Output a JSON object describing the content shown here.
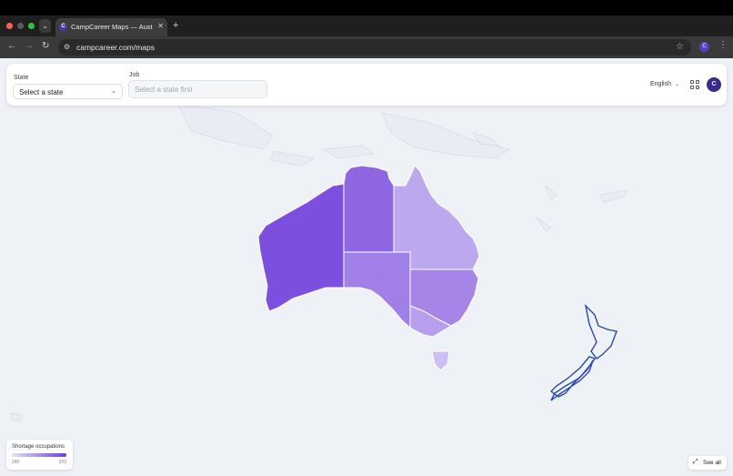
{
  "browser": {
    "tab_title": "CampCareer Maps — Australi",
    "tab_favicon_letter": "C",
    "url": "campcareer.com/maps",
    "profile_initial": "C",
    "icons": [
      "back-icon",
      "forward-icon",
      "reload-icon",
      "site-settings-icon",
      "star-icon",
      "kebab-menu-icon"
    ]
  },
  "filters": {
    "state_label": "State",
    "state_value": "Select a state",
    "job_label": "Job",
    "job_placeholder": "Select a state first"
  },
  "header": {
    "language": "English",
    "avatar_initial": "C"
  },
  "legend": {
    "title": "Shortage occupations",
    "min": "280",
    "max": "329",
    "color_low": "#e6e0f7",
    "color_high": "#6a3fd8"
  },
  "see_all_label": "See all",
  "map": {
    "regions": [
      {
        "name": "Western Australia",
        "shortage_level": 0.95,
        "color": "#7d4fdf"
      },
      {
        "name": "Northern Territory",
        "shortage_level": 0.75,
        "color": "#8f66e2"
      },
      {
        "name": "South Australia",
        "shortage_level": 0.6,
        "color": "#a080e6"
      },
      {
        "name": "Queensland",
        "shortage_level": 0.35,
        "color": "#bca8ee"
      },
      {
        "name": "New South Wales",
        "shortage_level": 0.6,
        "color": "#a586e7"
      },
      {
        "name": "Victoria",
        "shortage_level": 0.4,
        "color": "#b79fed"
      },
      {
        "name": "Tasmania",
        "shortage_level": 0.2,
        "color": "#cdbff3"
      }
    ],
    "new_zealand_outline_color": "#2b4aa8"
  }
}
